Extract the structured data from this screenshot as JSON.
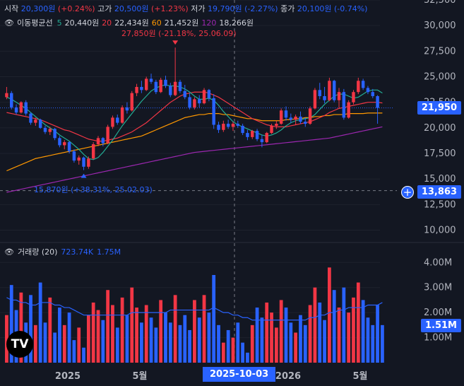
{
  "ohlc": {
    "open_label": "시작",
    "open": "20,300원",
    "open_chg": "(+0.24%)",
    "high_label": "고가",
    "high": "20,500원",
    "high_chg": "(+1.23%)",
    "low_label": "저가",
    "low": "19,790원",
    "low_chg": "(-2.27%)",
    "close_label": "종가",
    "close": "20,100원",
    "close_chg": "(-0.74%)"
  },
  "ma_legend": {
    "title": "이동평균선",
    "items": [
      {
        "period": "5",
        "value": "20,440원",
        "color": "#22ab94"
      },
      {
        "period": "20",
        "value": "22,434원",
        "color": "#f23645"
      },
      {
        "period": "60",
        "value": "21,452원",
        "color": "#ff9800"
      },
      {
        "period": "120",
        "value": "18,266원",
        "color": "#9c27b0"
      }
    ]
  },
  "volume_legend": {
    "title": "거래량 (20)",
    "v1": "723.74K",
    "v2": "1.75M"
  },
  "annotations": {
    "high": "27,850원 (-21.18%, 25.06.09)",
    "low": "15,870원 (+38.31%, 25.02.03)"
  },
  "price_tags": {
    "current": "21,950",
    "crosshair": "13,863",
    "volume": "1.51M"
  },
  "crosshair_date": "2025-10-03",
  "colors": {
    "up": "#f23645",
    "down": "#2962ff",
    "background": "#131722"
  },
  "icons": [
    "eye-icon",
    "plus-circle-icon",
    "tradingview-logo-icon"
  ],
  "chart_data": {
    "type": "candlestick",
    "price_axis": {
      "ticks": [
        "32,500",
        "30,000",
        "27,500",
        "25,000",
        "22,500",
        "20,000",
        "17,500",
        "15,000",
        "12,500",
        "10,000"
      ],
      "range": [
        9000,
        32500
      ]
    },
    "volume_axis": {
      "ticks": [
        "4.00M",
        "3.00M",
        "2.00M",
        "1.00M"
      ],
      "range": [
        0,
        4.6
      ]
    },
    "x_ticks": [
      "2025",
      "5월",
      "2026",
      "5월"
    ],
    "price_series": [
      [
        23000,
        24000,
        22800,
        23400
      ],
      [
        23400,
        23600,
        21800,
        22000
      ],
      [
        22000,
        22300,
        21300,
        21500
      ],
      [
        21500,
        22600,
        21400,
        22500
      ],
      [
        22500,
        22700,
        21200,
        21400
      ],
      [
        21400,
        21500,
        20300,
        20500
      ],
      [
        20500,
        21000,
        20200,
        20800
      ],
      [
        20800,
        20900,
        19900,
        20000
      ],
      [
        20000,
        20200,
        19400,
        19600
      ],
      [
        19600,
        20100,
        19300,
        19900
      ],
      [
        19900,
        20000,
        18800,
        19000
      ],
      [
        19000,
        19200,
        18100,
        18300
      ],
      [
        18300,
        18800,
        17900,
        18600
      ],
      [
        18600,
        18700,
        17500,
        17700
      ],
      [
        17700,
        17900,
        16600,
        16800
      ],
      [
        16800,
        17300,
        16400,
        17100
      ],
      [
        17100,
        17200,
        15870,
        16200
      ],
      [
        16200,
        17200,
        16000,
        17000
      ],
      [
        17000,
        18600,
        16900,
        18400
      ],
      [
        18400,
        19200,
        18200,
        19000
      ],
      [
        19000,
        19100,
        18200,
        18500
      ],
      [
        18500,
        20300,
        18400,
        20100
      ],
      [
        20100,
        21200,
        19900,
        21000
      ],
      [
        21000,
        21300,
        20300,
        20500
      ],
      [
        20500,
        22200,
        20400,
        22000
      ],
      [
        22000,
        22500,
        21400,
        21700
      ],
      [
        21700,
        23600,
        21600,
        23400
      ],
      [
        23400,
        24300,
        23100,
        24000
      ],
      [
        24000,
        24600,
        23400,
        23700
      ],
      [
        23700,
        25000,
        23600,
        24800
      ],
      [
        24800,
        25300,
        24300,
        24500
      ],
      [
        24500,
        24700,
        23300,
        23500
      ],
      [
        23500,
        24900,
        23400,
        24700
      ],
      [
        24700,
        25100,
        23900,
        24100
      ],
      [
        24100,
        24400,
        23000,
        23200
      ],
      [
        23200,
        27850,
        23100,
        24500
      ],
      [
        24500,
        24700,
        23400,
        23600
      ],
      [
        23600,
        24200,
        22800,
        23000
      ],
      [
        23000,
        23400,
        21800,
        22000
      ],
      [
        22000,
        23000,
        21800,
        22800
      ],
      [
        22800,
        23200,
        22000,
        22400
      ],
      [
        22400,
        23900,
        22300,
        23700
      ],
      [
        23700,
        23800,
        22600,
        22900
      ],
      [
        22900,
        23300,
        19900,
        20300
      ],
      [
        20300,
        20600,
        19500,
        19800
      ],
      [
        19800,
        20700,
        19600,
        20400
      ],
      [
        20400,
        20800,
        19900,
        20100
      ],
      [
        20100,
        20600,
        19700,
        20400
      ],
      [
        20400,
        20700,
        20000,
        20200
      ],
      [
        20200,
        20400,
        19300,
        19500
      ],
      [
        19500,
        19800,
        18800,
        19100
      ],
      [
        19100,
        19800,
        18900,
        19700
      ],
      [
        19700,
        19900,
        18700,
        18900
      ],
      [
        18900,
        19300,
        18100,
        18600
      ],
      [
        18600,
        19600,
        18500,
        19500
      ],
      [
        19500,
        20400,
        19400,
        20200
      ],
      [
        20200,
        20700,
        19900,
        20400
      ],
      [
        20400,
        21900,
        20300,
        21700
      ],
      [
        21700,
        22100,
        20700,
        21000
      ],
      [
        21000,
        21400,
        20500,
        20800
      ],
      [
        20800,
        21300,
        20300,
        21100
      ],
      [
        21100,
        21600,
        20400,
        20600
      ],
      [
        20600,
        21000,
        20100,
        20400
      ],
      [
        20400,
        22100,
        20300,
        21900
      ],
      [
        21900,
        23900,
        21800,
        23700
      ],
      [
        23700,
        24400,
        22800,
        23100
      ],
      [
        23100,
        24000,
        22400,
        22700
      ],
      [
        22700,
        24900,
        22600,
        24600
      ],
      [
        24600,
        24700,
        22500,
        22700
      ],
      [
        22700,
        23900,
        21900,
        23500
      ],
      [
        23500,
        23800,
        20800,
        21000
      ],
      [
        21000,
        22700,
        20900,
        22500
      ],
      [
        22500,
        23700,
        22300,
        23500
      ],
      [
        23500,
        24900,
        23300,
        24600
      ],
      [
        24600,
        24800,
        23700,
        23900
      ],
      [
        23900,
        24100,
        23300,
        23500
      ],
      [
        23500,
        23800,
        22900,
        23100
      ],
      [
        23100,
        23200,
        20400,
        21950
      ]
    ],
    "volume_series": [
      1.9,
      3.1,
      2.1,
      2.8,
      1.6,
      2.7,
      1.5,
      3.2,
      1.6,
      2.6,
      1.2,
      2.2,
      1.5,
      2.0,
      0.9,
      1.4,
      0.6,
      1.9,
      2.4,
      2.1,
      1.7,
      2.9,
      2.3,
      1.4,
      2.6,
      1.9,
      3.0,
      2.2,
      1.6,
      2.3,
      1.8,
      1.4,
      2.5,
      2.0,
      1.6,
      2.7,
      1.5,
      1.9,
      1.3,
      2.5,
      1.8,
      2.7,
      2.0,
      3.5,
      1.5,
      0.8,
      1.3,
      1.0,
      1.6,
      0.8,
      0.4,
      1.5,
      2.2,
      1.8,
      2.4,
      2.0,
      1.4,
      2.5,
      2.2,
      1.6,
      1.2,
      1.9,
      1.5,
      2.3,
      3.0,
      2.4,
      1.7,
      3.8,
      2.9,
      2.2,
      3.0,
      2.0,
      2.6,
      3.2,
      2.5,
      1.8,
      1.5,
      2.3,
      1.5
    ],
    "ma_series": {
      "ma5": [
        23000,
        22800,
        22500,
        22200,
        21900,
        21500,
        21100,
        20700,
        20300,
        20000,
        19700,
        19300,
        19000,
        18700,
        18300,
        17900,
        17400,
        17000,
        16900,
        17100,
        17600,
        18200,
        18800,
        19500,
        20200,
        20800,
        21400,
        22000,
        22600,
        23100,
        23600,
        23900,
        24100,
        24200,
        24100,
        24100,
        24000,
        23800,
        23500,
        23100,
        22800,
        22800,
        22900,
        22700,
        22200,
        21600,
        21100,
        20600,
        20300,
        20100,
        19900,
        19700,
        19500,
        19300,
        19200,
        19300,
        19500,
        19800,
        20200,
        20500,
        20700,
        20800,
        20900,
        21000,
        21300,
        21800,
        22300,
        22700,
        23100,
        23300,
        23300,
        23100,
        22900,
        23000,
        23300,
        23600,
        23700,
        23700,
        23400
      ],
      "ma20": [
        21500,
        21400,
        21300,
        21200,
        21100,
        21000,
        20900,
        20800,
        20600,
        20400,
        20200,
        20000,
        19800,
        19700,
        19500,
        19300,
        19100,
        18900,
        18800,
        18700,
        18700,
        18800,
        18900,
        19000,
        19200,
        19400,
        19600,
        19900,
        20200,
        20500,
        20900,
        21300,
        21700,
        22100,
        22500,
        22800,
        23100,
        23300,
        23400,
        23500,
        23500,
        23500,
        23400,
        23200,
        23000,
        22700,
        22400,
        22100,
        21800,
        21500,
        21200,
        20900,
        20700,
        20500,
        20300,
        20200,
        20100,
        20100,
        20100,
        20200,
        20300,
        20400,
        20500,
        20600,
        20800,
        21000,
        21200,
        21500,
        21700,
        21900,
        22000,
        22100,
        22200,
        22300,
        22400,
        22500,
        22500,
        22500,
        22434
      ],
      "ma60": [
        15800,
        16000,
        16200,
        16400,
        16600,
        16800,
        17000,
        17100,
        17200,
        17300,
        17400,
        17500,
        17600,
        17700,
        17800,
        17900,
        18000,
        18100,
        18200,
        18300,
        18400,
        18500,
        18600,
        18700,
        18800,
        18900,
        19000,
        19100,
        19200,
        19400,
        19600,
        19800,
        20000,
        20200,
        20400,
        20600,
        20800,
        21000,
        21100,
        21200,
        21300,
        21300,
        21400,
        21400,
        21400,
        21300,
        21300,
        21200,
        21100,
        21000,
        20900,
        20900,
        20800,
        20700,
        20700,
        20700,
        20700,
        20700,
        20800,
        20800,
        20900,
        20900,
        21000,
        21000,
        21100,
        21100,
        21200,
        21200,
        21300,
        21300,
        21300,
        21400,
        21400,
        21400,
        21400,
        21450,
        21450,
        21450,
        21452
      ],
      "ma120": [
        13700,
        13800,
        13900,
        14000,
        14100,
        14200,
        14300,
        14400,
        14500,
        14600,
        14700,
        14800,
        14900,
        15000,
        15100,
        15200,
        15300,
        15400,
        15500,
        15600,
        15700,
        15800,
        15900,
        16000,
        16100,
        16200,
        16300,
        16400,
        16500,
        16600,
        16700,
        16800,
        16900,
        17000,
        17100,
        17200,
        17300,
        17400,
        17500,
        17600,
        17650,
        17700,
        17750,
        17800,
        17850,
        17900,
        17950,
        18000,
        18050,
        18100,
        18150,
        18200,
        18250,
        18300,
        18350,
        18400,
        18450,
        18500,
        18550,
        18600,
        18650,
        18700,
        18750,
        18800,
        18850,
        18900,
        18950,
        19000,
        19100,
        19200,
        19300,
        19400,
        19500,
        19600,
        19700,
        19800,
        19900,
        20000,
        20100
      ],
      "volume_ma20": [
        2.6,
        2.5,
        2.5,
        2.4,
        2.4,
        2.3,
        2.3,
        2.4,
        2.4,
        2.4,
        2.3,
        2.3,
        2.2,
        2.2,
        2.1,
        2.0,
        1.9,
        1.9,
        1.9,
        1.9,
        1.9,
        1.9,
        1.9,
        1.9,
        1.9,
        1.9,
        2.0,
        2.0,
        2.0,
        2.0,
        2.0,
        2.0,
        2.0,
        2.0,
        2.1,
        2.1,
        2.1,
        2.1,
        2.1,
        2.1,
        2.1,
        2.1,
        2.1,
        2.2,
        2.1,
        2.0,
        2.0,
        1.9,
        1.9,
        1.8,
        1.8,
        1.7,
        1.7,
        1.7,
        1.7,
        1.7,
        1.7,
        1.7,
        1.7,
        1.7,
        1.7,
        1.7,
        1.7,
        1.8,
        1.8,
        1.9,
        1.9,
        2.0,
        2.0,
        2.1,
        2.1,
        2.2,
        2.2,
        2.2,
        2.2,
        2.3,
        2.3,
        2.3,
        2.4
      ]
    }
  }
}
